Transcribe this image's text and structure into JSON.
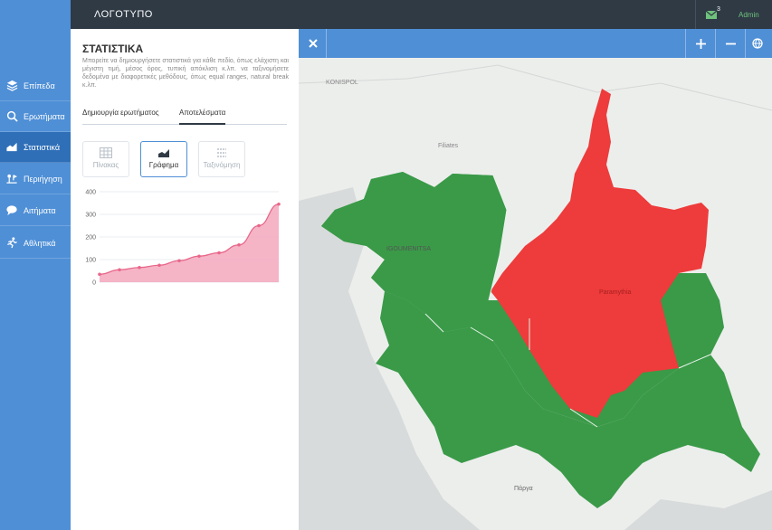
{
  "header": {
    "logo": "ΛΟΓΟΤΥΠΟ",
    "mail_count": "3",
    "user": "Admin"
  },
  "sidebar": {
    "items": [
      {
        "label": "Επίπεδα",
        "icon": "layers-icon"
      },
      {
        "label": "Ερωτήματα",
        "icon": "search-icon"
      },
      {
        "label": "Στατιστικά",
        "icon": "statistics-icon"
      },
      {
        "label": "Περιήγηση",
        "icon": "tour-icon"
      },
      {
        "label": "Αιτήματα",
        "icon": "chat-icon"
      },
      {
        "label": "Αθλητικά",
        "icon": "running-icon"
      }
    ]
  },
  "panel": {
    "title": "ΣΤΑΤΙΣΤΙΚΑ",
    "description": "Μπορείτε να δημιουργήσετε στατιστικά για κάθε πεδίο, όπως ελάχιστη και μέγιστη τιμή, μέσος όρος, τυπική απόκλιση κ.λπ. να ταξινομήσετε δεδομένα με διαφορετικές μεθόδους, όπως equal ranges, natural break κ.λπ.",
    "tabs": [
      {
        "label": "Δημιουργία ερωτήματος"
      },
      {
        "label": "Αποτελέσματα"
      }
    ],
    "view_buttons": [
      {
        "label": "Πίνακας",
        "icon": "table-icon"
      },
      {
        "label": "Γράφημα",
        "icon": "chart-icon"
      },
      {
        "label": "Ταξινόμηση",
        "icon": "classify-icon"
      }
    ]
  },
  "chart_data": {
    "type": "area",
    "x": [
      1,
      2,
      3,
      4,
      5,
      6,
      7,
      8,
      9,
      10
    ],
    "values": [
      35,
      55,
      65,
      75,
      95,
      115,
      130,
      165,
      250,
      345
    ],
    "ylim": [
      0,
      400
    ],
    "yticks": [
      0,
      100,
      200,
      300,
      400
    ],
    "title": "",
    "xlabel": "",
    "ylabel": "",
    "color": "#f4a7bd",
    "line_color": "#e8678a"
  },
  "map": {
    "labels": {
      "konispol": "KONISPOL",
      "filiates": "Filiates",
      "igoumenitsa": "IGOUMENITSA",
      "paramythia": "Paramythia",
      "parga": "Πάργα"
    },
    "colors": {
      "green": "#3a9a48",
      "red": "#ee3b3b"
    }
  }
}
